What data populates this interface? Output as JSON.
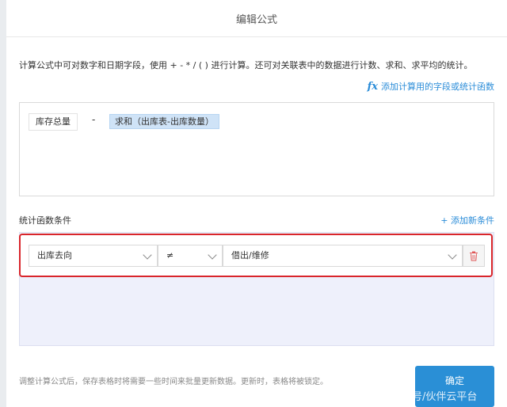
{
  "dialog": {
    "title": "编辑公式",
    "hint": "计算公式中可对数字和日期字段，使用 + - * / ( ) 进行计算。还可对关联表中的数据进行计数、求和、求平均的统计。",
    "add_field_link": "添加计算用的字段或统计函数",
    "add_field_icon": "fx-icon"
  },
  "formula": {
    "field_token": "库存总量",
    "operator": "-",
    "function_token": "求和（出库表-出库数量）"
  },
  "conditions": {
    "section_title": "统计函数条件",
    "add_condition_label": "+ 添加新条件",
    "rows": [
      {
        "field": "出库去向",
        "operator": "≠",
        "value": "借出/维修"
      }
    ]
  },
  "footer": {
    "note": "调整计算公式后，保存表格时将需要一些时间来批量更新数据。更新时，表格将被锁定。",
    "confirm_label": "确定"
  },
  "watermark": "号/伙伴云平台",
  "colors": {
    "accent": "#2a8cd8",
    "highlight_border": "#d9252b",
    "token_bg": "#cfe3f7"
  }
}
